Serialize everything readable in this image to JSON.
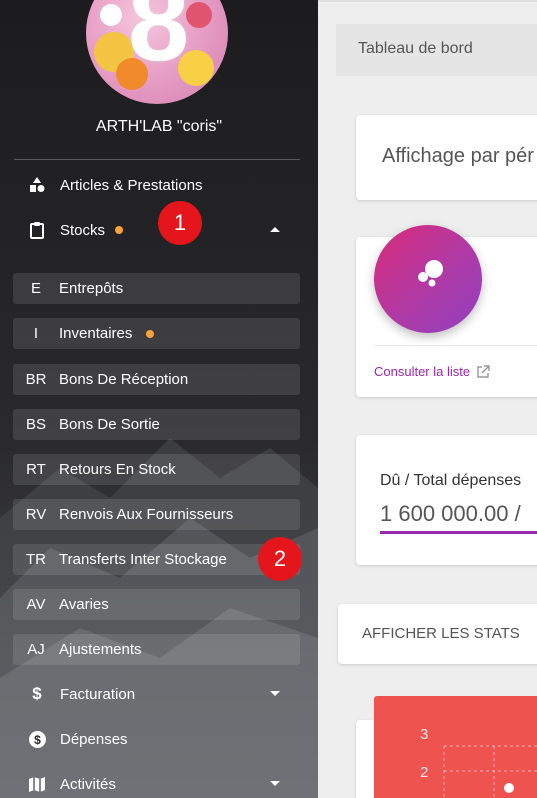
{
  "sidebar": {
    "brand": "ARTH'LAB \"coris\"",
    "logo_number": "8",
    "menu": [
      {
        "label": "Articles & Prestations",
        "icon": "shapes-icon"
      },
      {
        "label": "Stocks",
        "icon": "clipboard-icon"
      }
    ],
    "stocks_submenu": [
      {
        "abbr": "E",
        "label": "Entrepôts"
      },
      {
        "abbr": "I",
        "label": "Inventaires"
      },
      {
        "abbr": "BR",
        "label": "Bons De Réception"
      },
      {
        "abbr": "BS",
        "label": "Bons De Sortie"
      },
      {
        "abbr": "RT",
        "label": "Retours En Stock"
      },
      {
        "abbr": "RV",
        "label": "Renvois Aux Fournisseurs"
      },
      {
        "abbr": "TR",
        "label": "Transferts Inter Stockage"
      },
      {
        "abbr": "AV",
        "label": "Avaries"
      },
      {
        "abbr": "AJ",
        "label": "Ajustements"
      }
    ],
    "menu_bottom": [
      {
        "label": "Facturation",
        "icon": "dollar-icon"
      },
      {
        "label": "Dépenses",
        "icon": "dollar-circle-icon"
      },
      {
        "label": "Activités",
        "icon": "map-icon"
      }
    ],
    "dot_color": "#f7a33a"
  },
  "annotations": {
    "badge_1": "1",
    "badge_2": "2",
    "color": "#e5151c"
  },
  "main": {
    "breadcrumb": "Tableau de bord",
    "period_label": "Affichage par pér",
    "stat_link": "Consulter la liste",
    "due_label": "Dû / Total dépenses",
    "due_value": "1 600 000.00 /",
    "stats_button": "AFFICHER LES STATS",
    "chart_ticks": [
      "3",
      "2"
    ],
    "accent": "#9c27b0"
  }
}
